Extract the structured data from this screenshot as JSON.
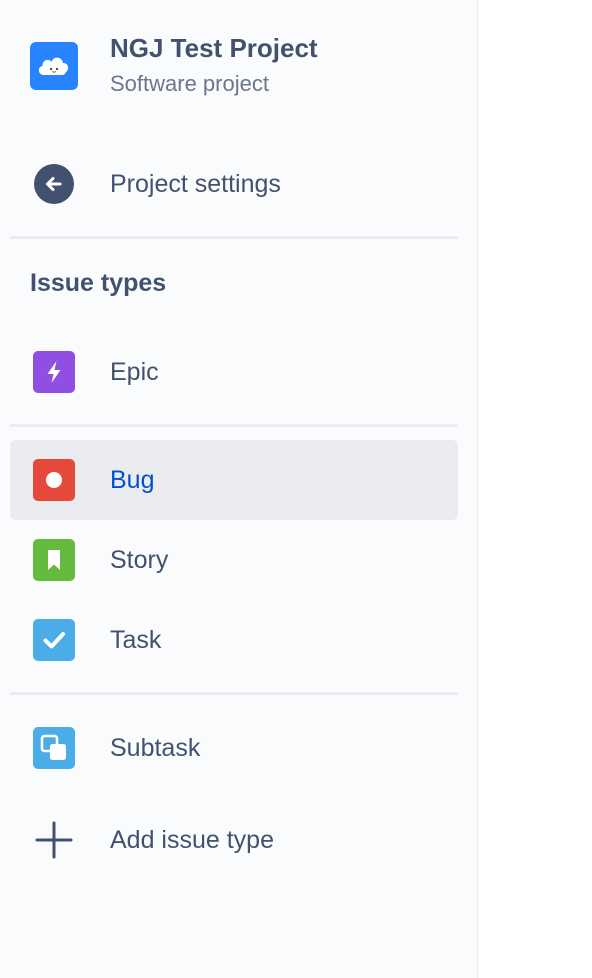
{
  "project": {
    "name": "NGJ Test Project",
    "type": "Software project",
    "avatar_color": "#2684ff"
  },
  "back_nav": {
    "label": "Project settings",
    "icon": "arrow-left-circle-icon"
  },
  "issue_types": {
    "title": "Issue types",
    "items": [
      {
        "label": "Epic",
        "icon": "epic-icon",
        "color": "#904ee2",
        "selected": false
      },
      {
        "label": "Bug",
        "icon": "bug-icon",
        "color": "#e5493a",
        "selected": true
      },
      {
        "label": "Story",
        "icon": "story-icon",
        "color": "#63ba3c",
        "selected": false
      },
      {
        "label": "Task",
        "icon": "task-icon",
        "color": "#4bade8",
        "selected": false
      },
      {
        "label": "Subtask",
        "icon": "subtask-icon",
        "color": "#4bade8",
        "selected": false
      }
    ],
    "add_label": "Add issue type"
  },
  "colors": {
    "sidebar_bg": "#fafbfc",
    "text": "#42526e",
    "selected_text": "#0052cc",
    "selected_bg": "#ebecf0"
  }
}
